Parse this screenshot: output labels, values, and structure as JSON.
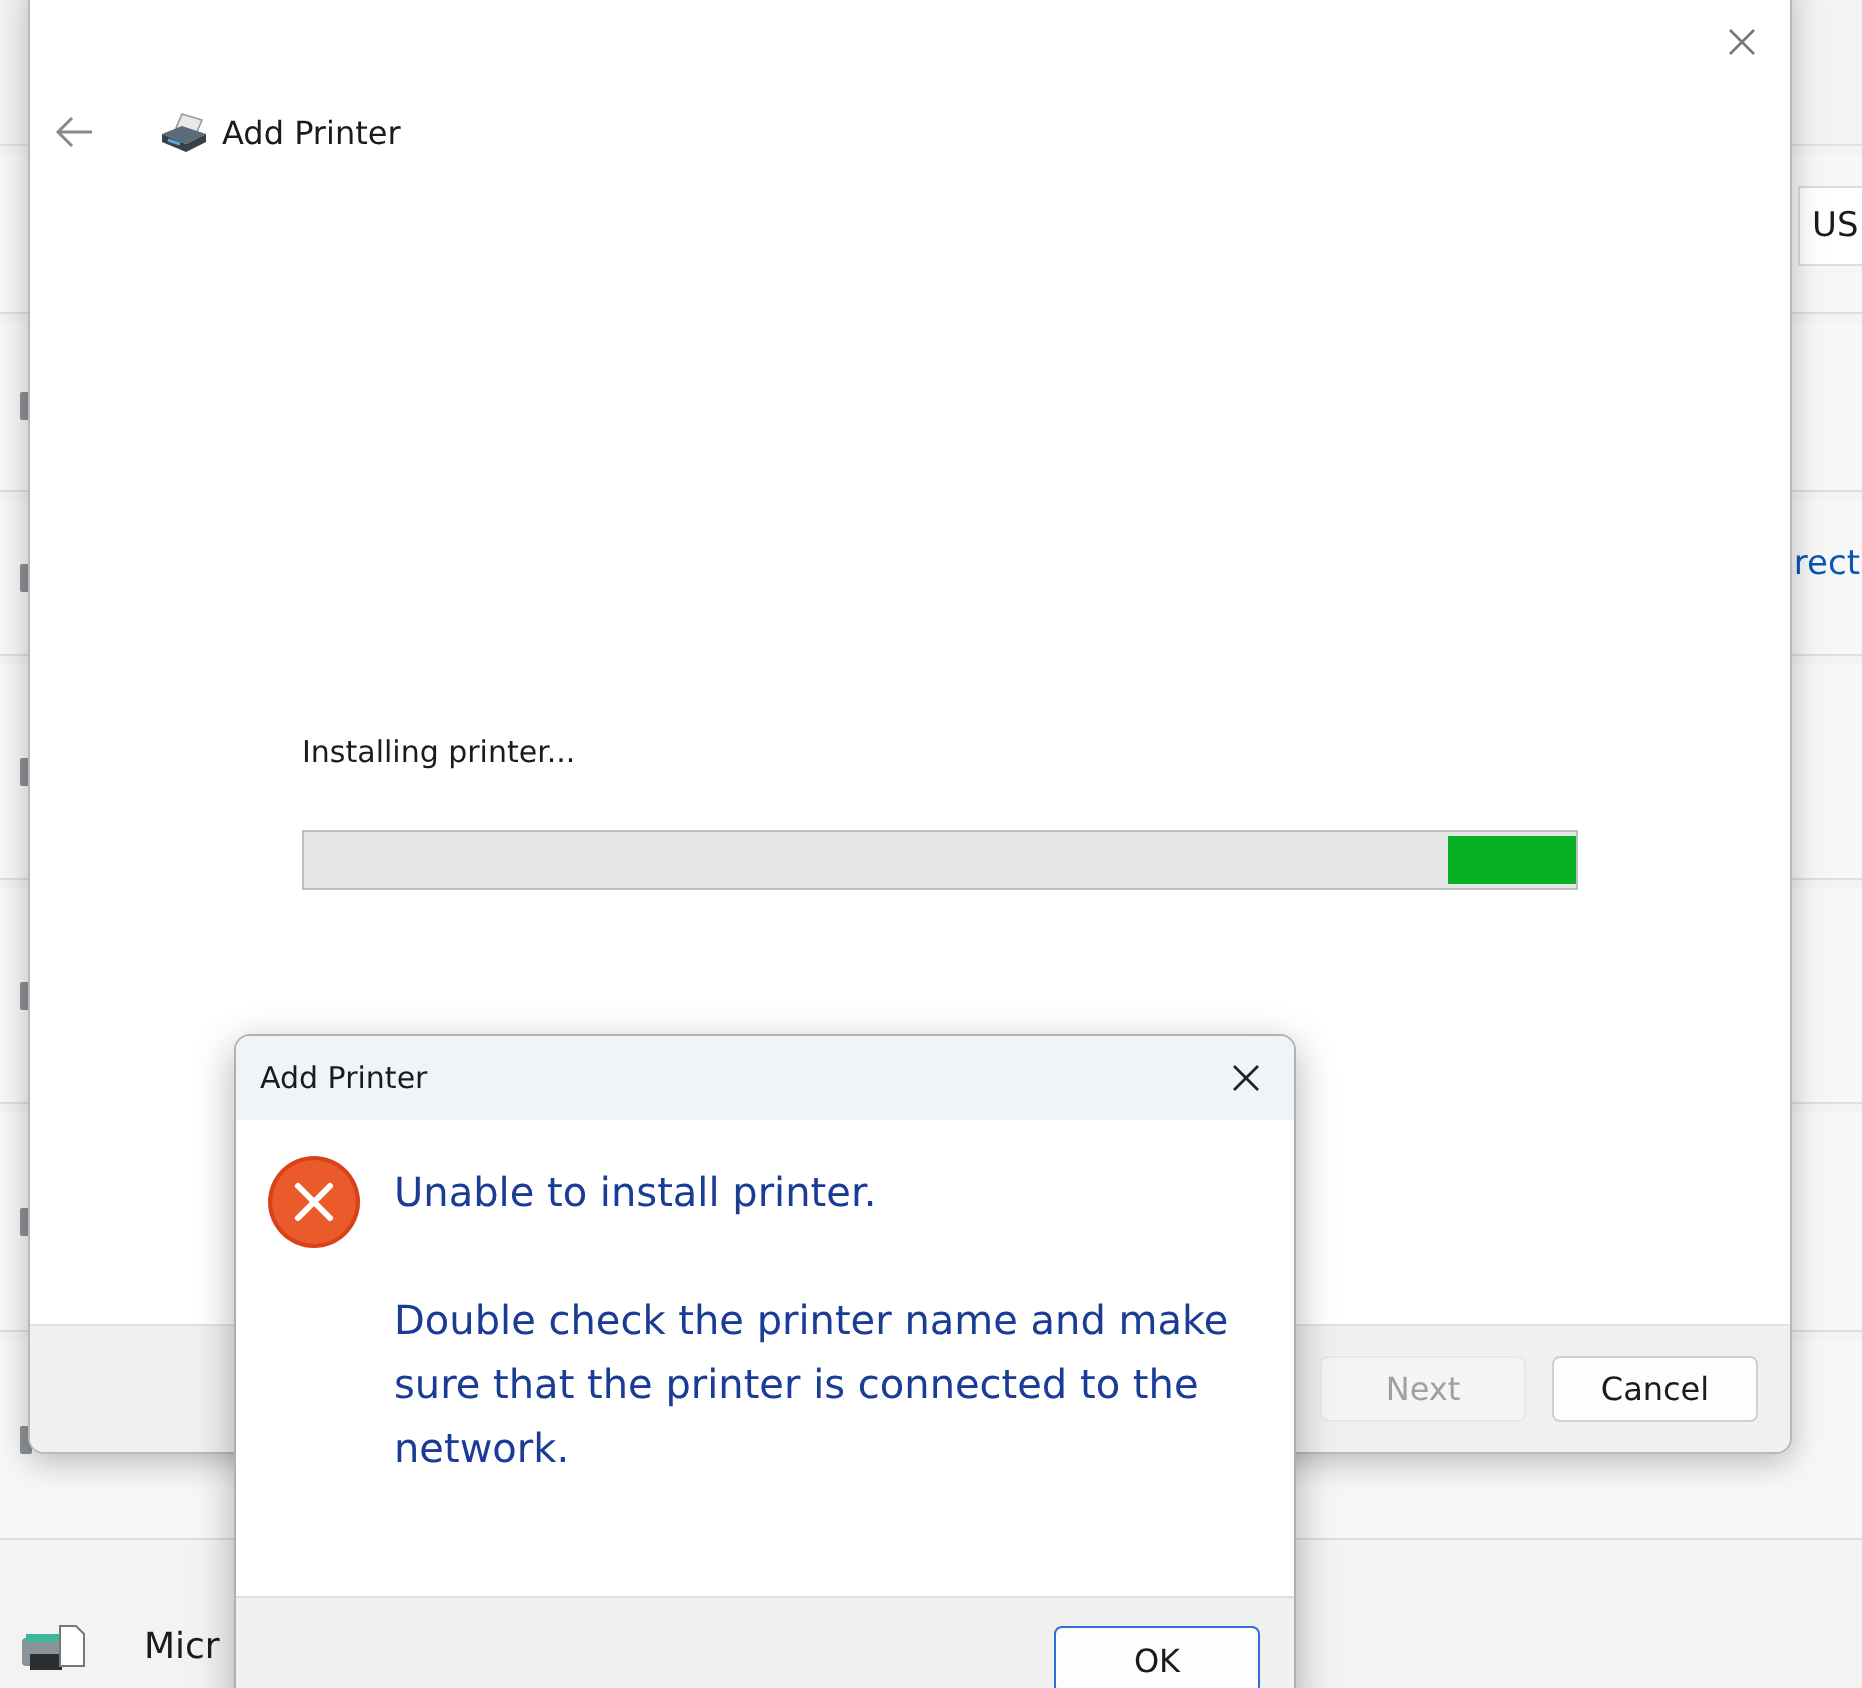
{
  "background_page": {
    "field_fragment": "US",
    "link_fragment": "rect",
    "printer_fragment": "Micr"
  },
  "wizard": {
    "title": "Add Printer",
    "status": "Installing printer...",
    "progress": {
      "level": 0.1
    },
    "buttons": [
      {
        "label": "Next",
        "disabled": true
      },
      {
        "label": "Cancel",
        "disabled": false
      }
    ]
  },
  "dialog": {
    "title": "Add Printer",
    "heading": "Unable to install printer.",
    "message": "Double check the printer name and make sure that the printer is connected to the network.",
    "kind": "error",
    "buttons": [
      "OK"
    ]
  }
}
